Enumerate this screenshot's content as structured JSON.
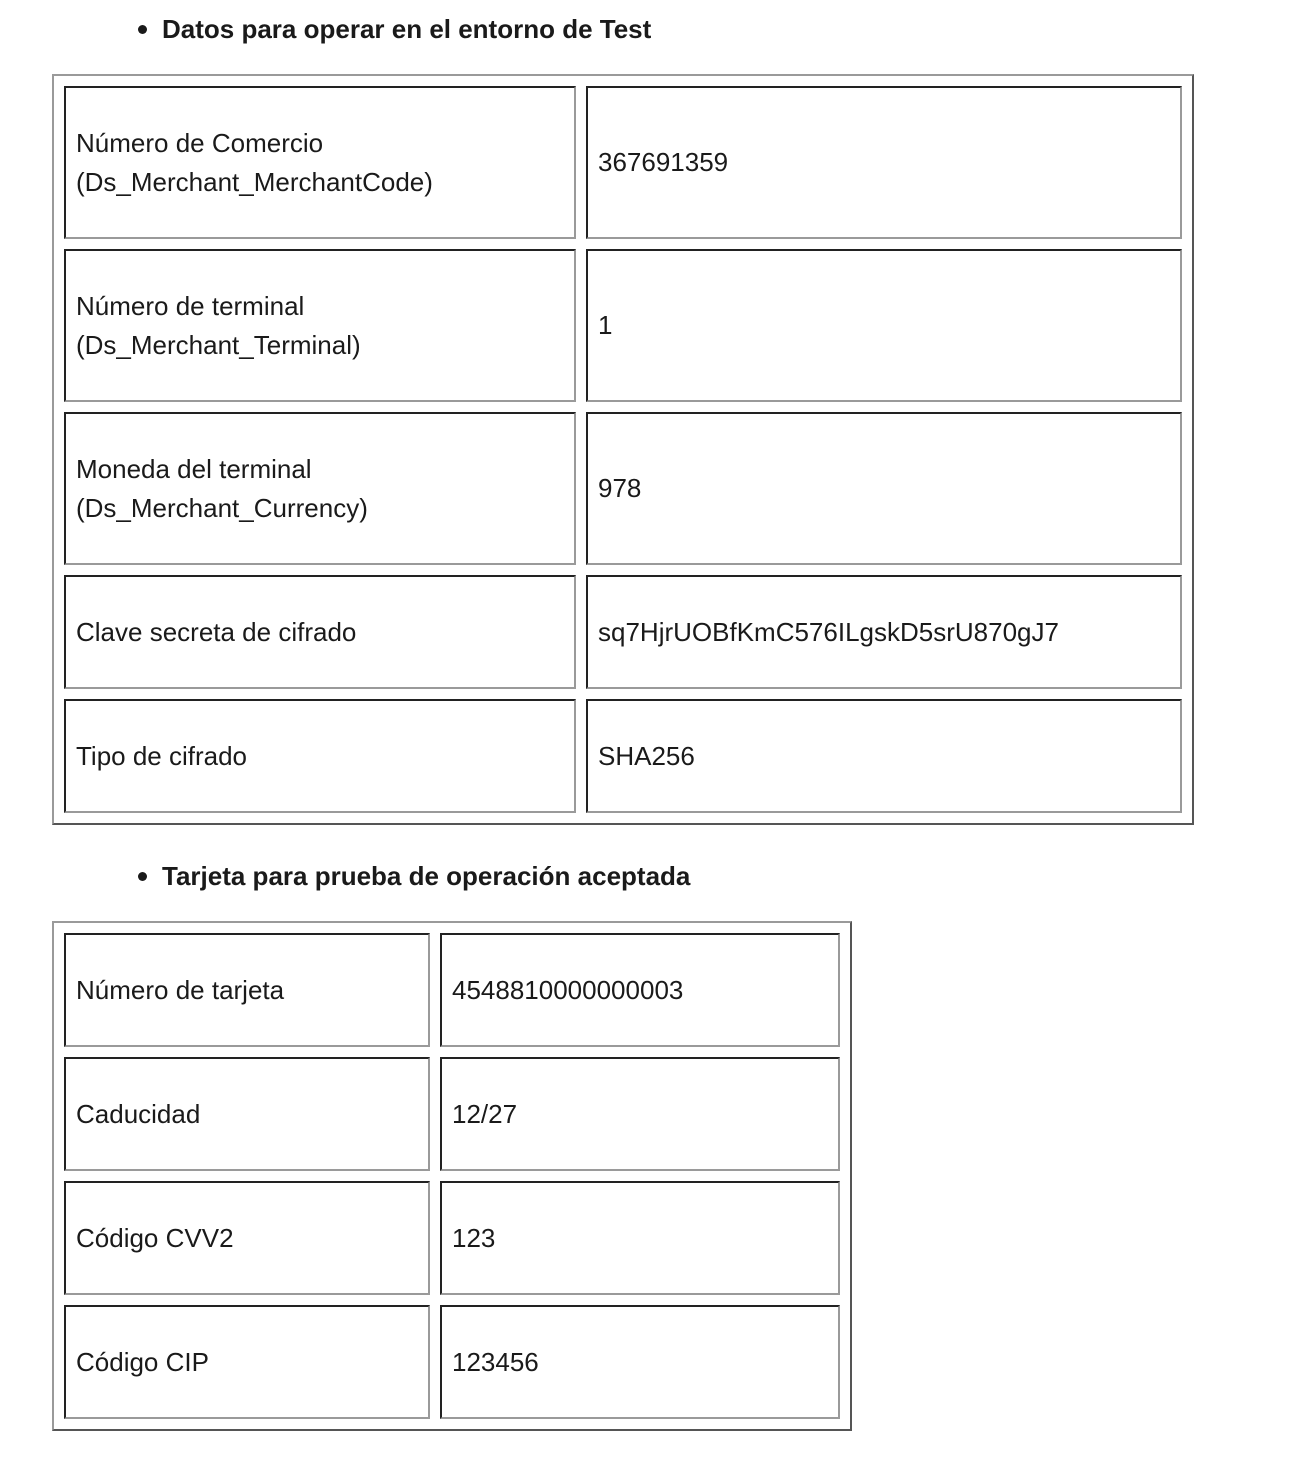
{
  "sections": [
    {
      "title": "Datos para operar en el entorno de Test",
      "rows": [
        {
          "label": "Número de Comercio",
          "sublabel": "(Ds_Merchant_MerchantCode)",
          "value": "367691359"
        },
        {
          "label": "Número de terminal",
          "sublabel": "(Ds_Merchant_Terminal)",
          "value": "1"
        },
        {
          "label": "Moneda del terminal",
          "sublabel": "(Ds_Merchant_Currency)",
          "value": "978"
        },
        {
          "label": "Clave secreta de cifrado",
          "value": "sq7HjrUOBfKmC576ILgskD5srU870gJ7"
        },
        {
          "label": "Tipo de cifrado",
          "value": "SHA256"
        }
      ]
    },
    {
      "title": "Tarjeta para prueba de operación aceptada",
      "rows": [
        {
          "label": "Número de tarjeta",
          "value": "4548810000000003"
        },
        {
          "label": "Caducidad",
          "value": "12/27"
        },
        {
          "label": "Código CVV2",
          "value": "123"
        },
        {
          "label": "Código CIP",
          "value": "123456"
        }
      ]
    }
  ]
}
